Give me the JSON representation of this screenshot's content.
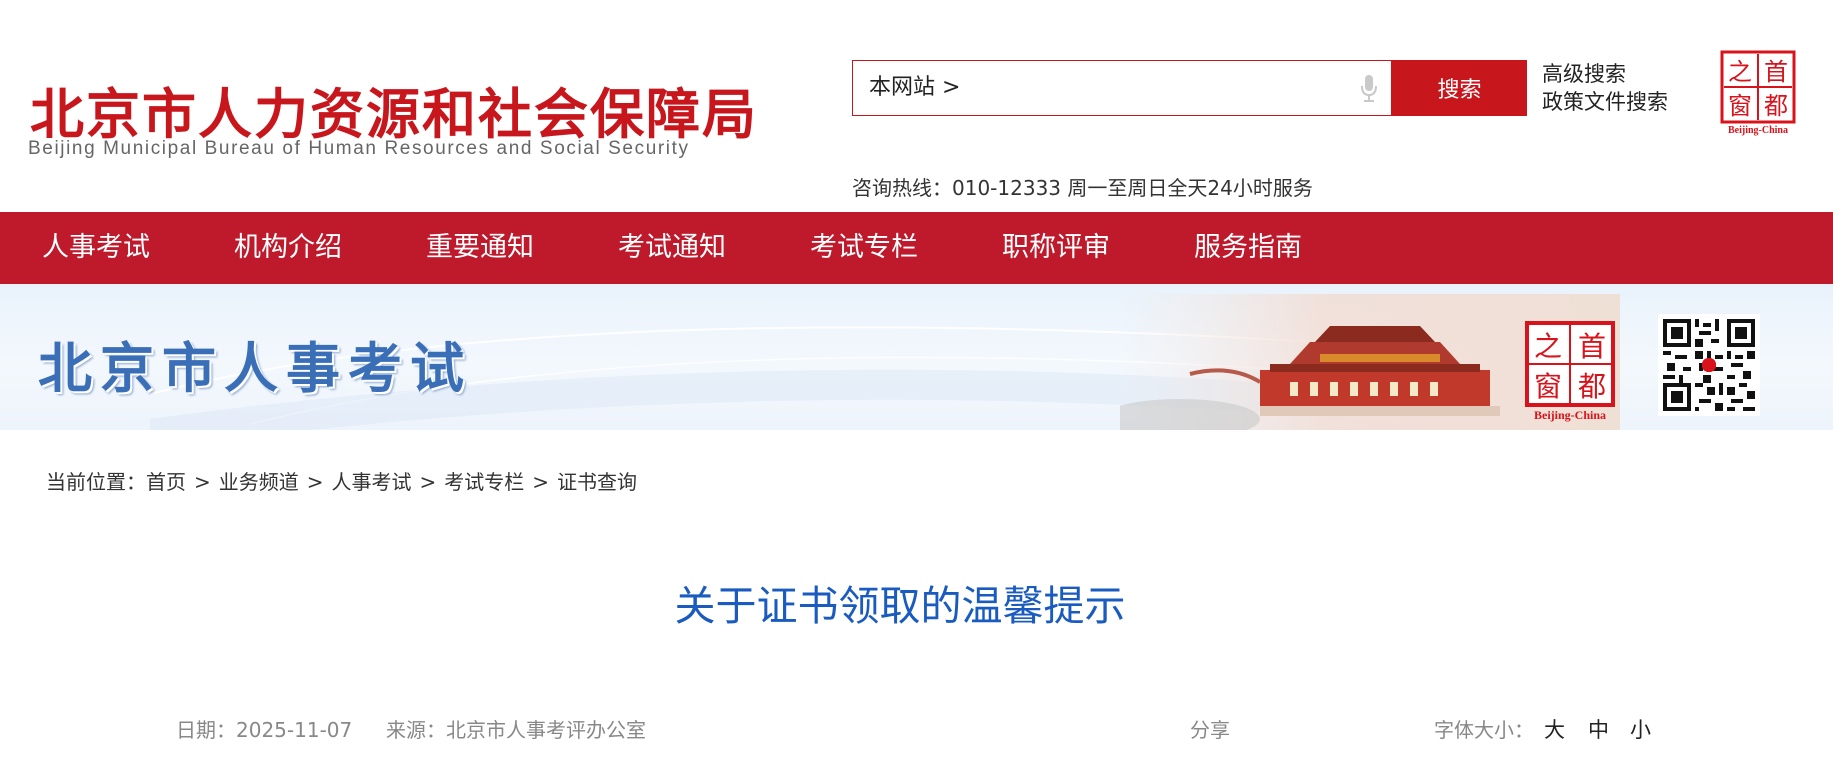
{
  "header": {
    "logo_cn": "北京市人力资源和社会保障局",
    "logo_en": "Beijing Municipal Bureau of Human Resources and Social Security",
    "search_scope": "本网站 >",
    "search_placeholder": "",
    "search_button": "搜索",
    "advanced_search": "高级搜索",
    "policy_search": "政策文件搜索",
    "capital_logo": {
      "chars": [
        "之",
        "首",
        "窗",
        "都"
      ],
      "caption": "Beijing-China"
    },
    "hotline": "咨询热线：010-12333 周一至周日全天24小时服务"
  },
  "nav": {
    "items": [
      {
        "label": "人事考试"
      },
      {
        "label": "机构介绍"
      },
      {
        "label": "重要通知"
      },
      {
        "label": "考试通知"
      },
      {
        "label": "考试专栏"
      },
      {
        "label": "职称评审"
      },
      {
        "label": "服务指南"
      }
    ]
  },
  "banner": {
    "title": "北京市人事考试",
    "logo": {
      "chars": [
        "之",
        "首",
        "窗",
        "都"
      ],
      "caption": "Beijing-China"
    }
  },
  "breadcrumb": {
    "prefix": "当前位置：",
    "items": [
      "首页",
      "业务频道",
      "人事考试",
      "考试专栏",
      "证书查询"
    ],
    "separator": ">"
  },
  "article": {
    "title": "关于证书领取的温馨提示",
    "date": "日期：2025-11-07",
    "source": "来源：北京市人事考评办公室",
    "share": "分享",
    "font_size_label": "字体大小：",
    "font_sizes": [
      "大",
      "中",
      "小"
    ]
  },
  "colors": {
    "brand_red": "#c8161d",
    "nav_red": "#be1a2c",
    "title_blue": "#1a5bbf",
    "banner_blue": "#3a6fb8"
  }
}
